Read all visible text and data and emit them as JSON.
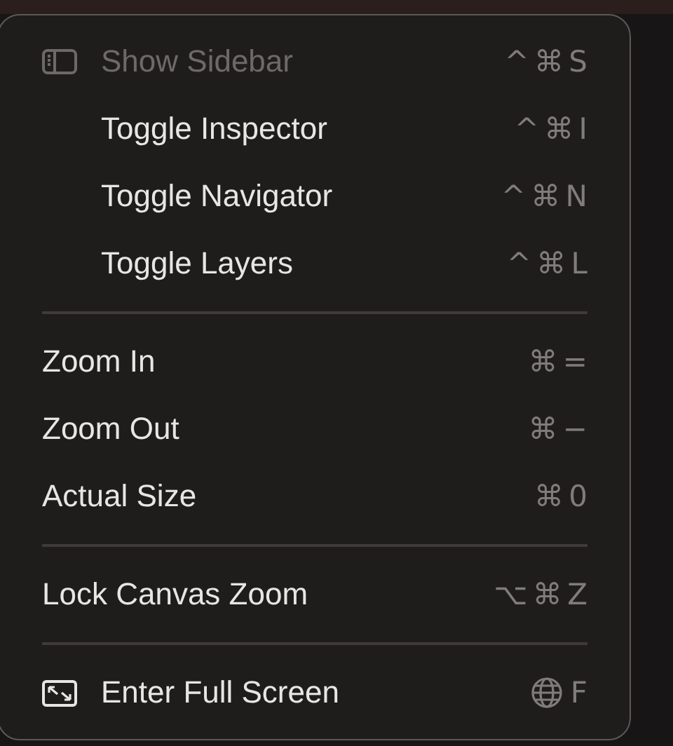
{
  "menu": {
    "items": [
      {
        "kind": "sidebar-item",
        "label": "Show Sidebar",
        "disabled": true,
        "shortcut": "^ ⌘ S"
      },
      {
        "kind": "indented-item",
        "label": "Toggle Inspector",
        "disabled": false,
        "shortcut": "^ ⌘ I"
      },
      {
        "kind": "indented-item",
        "label": "Toggle Navigator",
        "disabled": false,
        "shortcut": "^ ⌘ N"
      },
      {
        "kind": "indented-item",
        "label": "Toggle Layers",
        "disabled": false,
        "shortcut": "^ ⌘ L"
      },
      {
        "kind": "separator"
      },
      {
        "kind": "item",
        "label": "Zoom In",
        "disabled": false,
        "shortcut": "⌘ ="
      },
      {
        "kind": "item",
        "label": "Zoom Out",
        "disabled": false,
        "shortcut": "⌘ −"
      },
      {
        "kind": "item",
        "label": "Actual Size",
        "disabled": false,
        "shortcut": "⌘ 0"
      },
      {
        "kind": "separator"
      },
      {
        "kind": "item",
        "label": "Lock Canvas Zoom",
        "disabled": false,
        "shortcut": "⌥ ⌘ Z"
      },
      {
        "kind": "separator"
      },
      {
        "kind": "fullscreen-item",
        "label": "Enter Full Screen",
        "disabled": false,
        "shortcut": "F"
      }
    ]
  }
}
